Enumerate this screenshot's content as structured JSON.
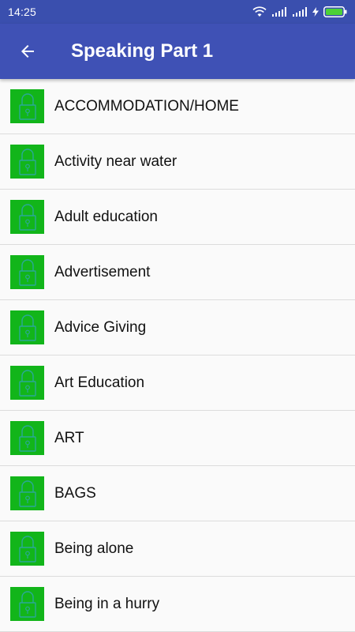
{
  "status_bar": {
    "time": "14:25",
    "icons": [
      "wifi-icon",
      "signal-icon",
      "signal-icon",
      "charging-icon",
      "battery-icon"
    ]
  },
  "app_bar": {
    "back_icon": "arrow-left-icon",
    "title": "Speaking Part 1"
  },
  "colors": {
    "status_bar": "#3a4fae",
    "app_bar": "#3f51b5",
    "thumb": "#12b51a",
    "battery": "#4cd137"
  },
  "topics": [
    {
      "label": "ACCOMMODATION/HOME",
      "icon": "lock-icon"
    },
    {
      "label": "Activity near water",
      "icon": "lock-icon"
    },
    {
      "label": "Adult education",
      "icon": "lock-icon"
    },
    {
      "label": "Advertisement",
      "icon": "lock-icon"
    },
    {
      "label": "Advice Giving",
      "icon": "lock-icon"
    },
    {
      "label": "Art Education",
      "icon": "lock-icon"
    },
    {
      "label": "ART",
      "icon": "lock-icon"
    },
    {
      "label": "BAGS",
      "icon": "lock-icon"
    },
    {
      "label": "Being alone",
      "icon": "lock-icon"
    },
    {
      "label": "Being in a hurry",
      "icon": "lock-icon"
    }
  ]
}
